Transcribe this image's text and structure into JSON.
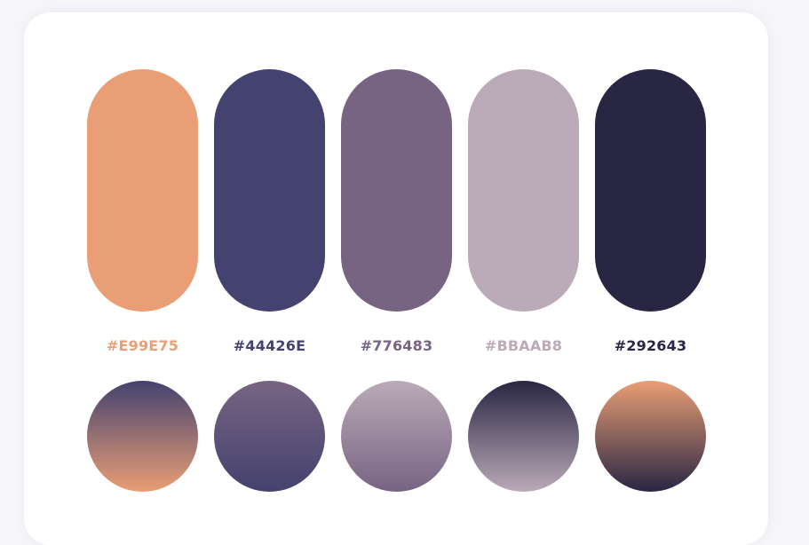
{
  "palette": {
    "swatches": [
      {
        "hex": "#E99E75",
        "color": "#E99E75"
      },
      {
        "hex": "#44426E",
        "color": "#44426E"
      },
      {
        "hex": "#776483",
        "color": "#776483"
      },
      {
        "hex": "#BBAAB8",
        "color": "#BBAAB8"
      },
      {
        "hex": "#292643",
        "color": "#292643"
      }
    ],
    "gradients": [
      {
        "from": "#44426E",
        "to": "#E99E75"
      },
      {
        "from": "#776483",
        "to": "#44426E"
      },
      {
        "from": "#BBAAB8",
        "to": "#776483"
      },
      {
        "from": "#292643",
        "to": "#BBAAB8"
      },
      {
        "from": "#E99E75",
        "to": "#292643"
      }
    ]
  }
}
